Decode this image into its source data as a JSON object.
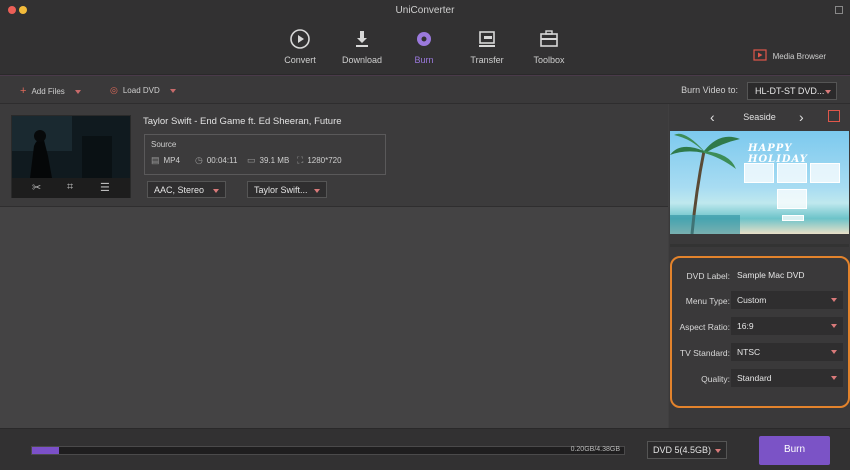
{
  "window": {
    "title": "UniConverter"
  },
  "toolbar": {
    "tabs": [
      {
        "label": "Convert",
        "icon": "convert-icon"
      },
      {
        "label": "Download",
        "icon": "download-icon"
      },
      {
        "label": "Burn",
        "icon": "burn-icon",
        "active": true
      },
      {
        "label": "Transfer",
        "icon": "transfer-icon"
      },
      {
        "label": "Toolbox",
        "icon": "toolbox-icon"
      }
    ],
    "media_browser": "Media Browser"
  },
  "subbar": {
    "add_files": "Add Files",
    "load_dvd": "Load DVD",
    "burn_to_label": "Burn Video to:",
    "burn_to_value": "HL-DT-ST DVD..."
  },
  "file": {
    "title": "Taylor Swift - End Game ft. Ed Sheeran, Future",
    "source_label": "Source",
    "format": "MP4",
    "duration": "00:04:11",
    "size": "39.1 MB",
    "resolution": "1280*720",
    "audio_track": "AAC, Stereo",
    "subtitle": "Taylor Swift..."
  },
  "template": {
    "name": "Seaside",
    "preview_title": "HAPPY HOLIDAY"
  },
  "settings": {
    "dvd_label": {
      "label": "DVD Label:",
      "value": "Sample Mac DVD"
    },
    "menu_type": {
      "label": "Menu Type:",
      "value": "Custom"
    },
    "aspect_ratio": {
      "label": "Aspect Ratio:",
      "value": "16:9"
    },
    "tv_standard": {
      "label": "TV Standard:",
      "value": "NTSC"
    },
    "quality": {
      "label": "Quality:",
      "value": "Standard"
    }
  },
  "bottom": {
    "progress_text": "0.20GB/4.38GB",
    "progress_fraction": 0.046,
    "disc_type": "DVD 5(4.5GB)",
    "burn_label": "Burn"
  },
  "colors": {
    "accent": "#7b53c6",
    "highlight_border": "#e3832c",
    "active_tab": "#9b79dd"
  }
}
